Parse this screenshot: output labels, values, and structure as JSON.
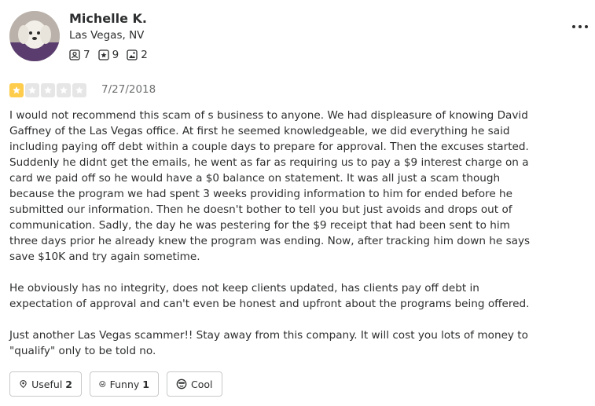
{
  "user": {
    "name": "Michelle K.",
    "location": "Las Vegas, NV",
    "friends_count": "7",
    "reviews_count": "9",
    "photos_count": "2"
  },
  "review": {
    "rating": 1,
    "max_rating": 5,
    "date": "7/27/2018",
    "paragraphs": [
      "I would not recommend this scam of s business to anyone. We had displeasure of knowing David Gaffney of the Las Vegas office. At first he seemed knowledgeable,  we did everything he said including paying off debt within a couple days to prepare for approval. Then the excuses started. Suddenly he didnt get the emails,  he went as far as requiring us to pay a $9 interest charge on a card we paid off so he would have a $0 balance on statement. It was all just a scam though because the program we had spent 3 weeks providing information to him for ended before he submitted our information.  Then he doesn't bother to tell you but just avoids and drops out of communication.  Sadly, the day he was pestering for the $9 receipt that had been sent to him three days prior he already knew the program was ending. Now, after tracking him down he says save $10K and try again sometime.",
      "He obviously has no integrity, does not keep clients updated, has clients pay off debt in expectation of approval and can't even be honest and upfront about the programs being offered.",
      "Just another Las Vegas scammer!! Stay away from this company. It will cost you lots of money to \"qualify\" only to be told no."
    ]
  },
  "reactions": {
    "useful_label": "Useful",
    "useful_count": "2",
    "funny_label": "Funny",
    "funny_count": "1",
    "cool_label": "Cool"
  },
  "colors": {
    "star_filled": "#ffcc4b",
    "star_empty": "#e6e6e6",
    "text": "#2d2e2f",
    "muted": "#6e7072",
    "border": "#c8c9ca"
  },
  "icons": [
    "friends-icon",
    "reviews-star-icon",
    "photos-icon",
    "more-options-icon",
    "star-icon",
    "useful-icon",
    "funny-icon",
    "cool-icon"
  ]
}
